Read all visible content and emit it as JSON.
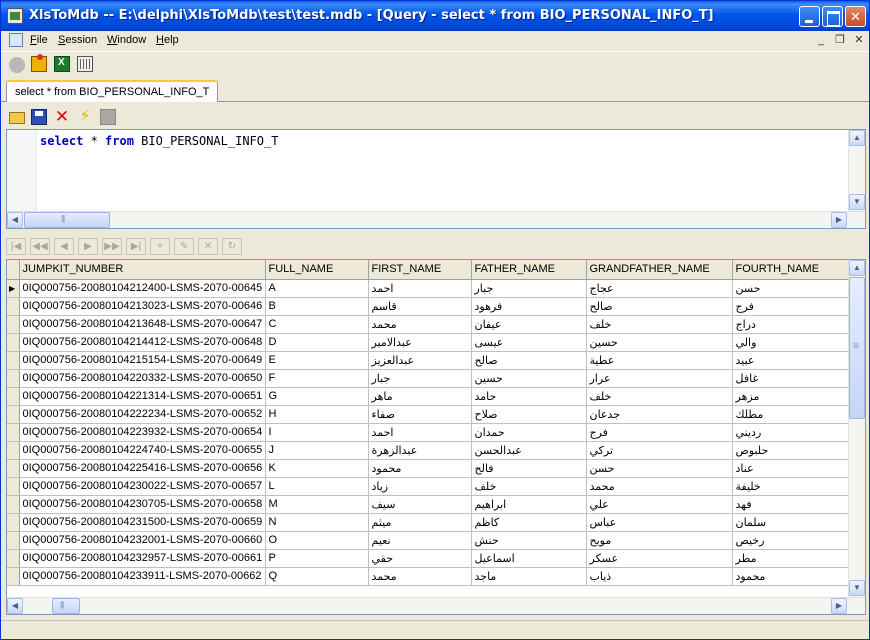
{
  "window": {
    "title": "XlsToMdb -- E:\\delphi\\XlsToMdb\\test\\test.mdb - [Query - select * from BIO_PERSONAL_INFO_T]"
  },
  "menu": {
    "items": [
      {
        "label": "File",
        "mnemonic": "F",
        "rest": "ile"
      },
      {
        "label": "Session",
        "mnemonic": "S",
        "rest": "ession"
      },
      {
        "label": "Window",
        "mnemonic": "W",
        "rest": "indow"
      },
      {
        "label": "Help",
        "mnemonic": "H",
        "rest": "elp"
      }
    ]
  },
  "toolbar": {
    "icons": [
      "disconnect-icon",
      "new-session-icon",
      "excel-import-icon",
      "grid-view-icon"
    ]
  },
  "tab": {
    "label": "select * from BIO_PERSONAL_INFO_T"
  },
  "query_toolbar": {
    "icons": [
      "open-icon",
      "save-icon",
      "delete-icon",
      "execute-icon",
      "stop-icon"
    ]
  },
  "editor": {
    "keyword1": "select",
    "middle": " * ",
    "keyword2": "from",
    "table": " BIO_PERSONAL_INFO_T"
  },
  "grid": {
    "columns": [
      "JUMPKIT_NUMBER",
      "FULL_NAME",
      "FIRST_NAME",
      "FATHER_NAME",
      "GRANDFATHER_NAME",
      "FOURTH_NAME"
    ],
    "rows": [
      [
        "0IQ000756-20080104212400-LSMS-2070-00645",
        "A",
        "احمد",
        "جبار",
        "عجاج",
        "حسن"
      ],
      [
        "0IQ000756-20080104213023-LSMS-2070-00646",
        "B",
        "قاسم",
        "فرهود",
        "صالح",
        "فرج"
      ],
      [
        "0IQ000756-20080104213648-LSMS-2070-00647",
        "C",
        "محمد",
        "عيفان",
        "خلف",
        "دراج"
      ],
      [
        "0IQ000756-20080104214412-LSMS-2070-00648",
        "D",
        "عبدالامير",
        "عيسى",
        "حسين",
        "والي"
      ],
      [
        "0IQ000756-20080104215154-LSMS-2070-00649",
        "E",
        "عبدالعزيز",
        "صالح",
        "عطية",
        "عبيد"
      ],
      [
        "0IQ000756-20080104220332-LSMS-2070-00650",
        "F",
        "جبار",
        "حسين",
        "عرار",
        "غافل"
      ],
      [
        "0IQ000756-20080104221314-LSMS-2070-00651",
        "G",
        "ماهر",
        "حامد",
        "خلف",
        "مزهر"
      ],
      [
        "0IQ000756-20080104222234-LSMS-2070-00652",
        "H",
        "صفاء",
        "صلاح",
        "جدعان",
        "مطلك"
      ],
      [
        "0IQ000756-20080104223932-LSMS-2070-00654",
        "I",
        "احمد",
        "حمدان",
        "فرج",
        "رديني"
      ],
      [
        "0IQ000756-20080104224740-LSMS-2070-00655",
        "J",
        "عبدالزهرة",
        "عبدالحسن",
        "تركي",
        "حلبوص"
      ],
      [
        "0IQ000756-20080104225416-LSMS-2070-00656",
        "K",
        "محمود",
        "فالح",
        "حسن",
        "عناد"
      ],
      [
        "0IQ000756-20080104230022-LSMS-2070-00657",
        "L",
        "زياد",
        "خلف",
        "محمد",
        "خليفة"
      ],
      [
        "0IQ000756-20080104230705-LSMS-2070-00658",
        "M",
        "سيف",
        "ابراهيم",
        "علي",
        "فهد"
      ],
      [
        "0IQ000756-20080104231500-LSMS-2070-00659",
        "N",
        "ميثم",
        "كاظم",
        "عباس",
        "سلمان"
      ],
      [
        "0IQ000756-20080104232001-LSMS-2070-00660",
        "O",
        "نعيم",
        "حنش",
        "مويح",
        "رخيص"
      ],
      [
        "0IQ000756-20080104232957-LSMS-2070-00661",
        "P",
        "حقي",
        "اسماعيل",
        "عسكر",
        "مطر"
      ],
      [
        "0IQ000756-20080104233911-LSMS-2070-00662",
        "Q",
        "محمد",
        "ماجد",
        "ذياب",
        "محمود"
      ]
    ],
    "active_row": 0
  }
}
